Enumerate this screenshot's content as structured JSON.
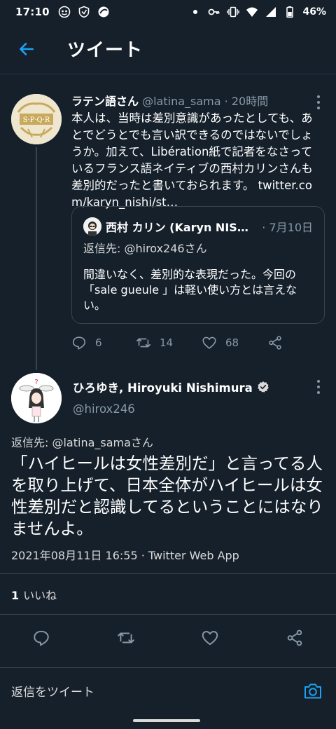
{
  "status_bar": {
    "time": "17:10",
    "battery": "46%",
    "icons": [
      "notification-icon",
      "shield-icon",
      "browser-icon",
      "dot-icon",
      "key-icon",
      "vibrate-icon",
      "wifi-icon",
      "cell-signal-icon",
      "battery-icon"
    ]
  },
  "header": {
    "title": "ツイート",
    "back_icon": "arrow-left-icon"
  },
  "parent_tweet": {
    "display_name": "ラテン語さん",
    "handle": "@latina_sama",
    "separator": "·",
    "time_ago": "20時間",
    "text": "本人は、当時は差別意識があったとしても、あとでどうとでも言い訳できるのではないでしょうか。加えて、Libération紙で記者をなさっているフランス語ネイティブの西村カリンさんも差別的だったと書いておられます。 twitter.com/karyn_nishi/st…",
    "quote": {
      "name": "西村 カリン (Karyn NISHIM…",
      "separator": "·",
      "date": "7月10日",
      "reply_to": "返信先: @hirox246さん",
      "text": "間違いなく、差別的な表現だった。今回の「sale gueule 」は軽い使い方とは言えない。"
    },
    "actions": {
      "reply_count": "6",
      "retweet_count": "14",
      "like_count": "68"
    }
  },
  "main_tweet": {
    "display_name": "ひろゆき, Hiroyuki Nishimura",
    "handle": "@hirox246",
    "verified": true,
    "reply_to": "返信先: @latina_samaさん",
    "text": "「ハイヒールは女性差別だ」と言ってる人を取り上げて、日本全体がハイヒールは女性差別だと認識してるということにはなりませんよ。",
    "timestamp": "2021年08月11日 16:55 · Twitter Web App",
    "likes_count": "1",
    "likes_label": "いいね"
  },
  "reply_bar": {
    "placeholder": "返信をツイート",
    "camera_icon": "camera-icon"
  },
  "colors": {
    "background": "#15202b",
    "accent": "#1da1f2",
    "muted": "#8899a6",
    "border": "#38444d"
  }
}
